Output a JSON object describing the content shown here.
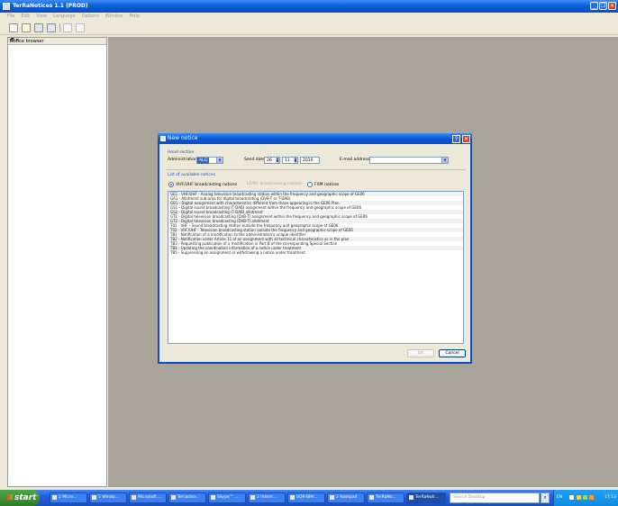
{
  "app": {
    "title": "TerRaNotices 1.1 (PROD)",
    "menu": [
      "File",
      "Edit",
      "View",
      "Language",
      "Options",
      "Window",
      "Help"
    ],
    "toolbar_icons": [
      "new-notice-icon",
      "open-notice-icon",
      "save-icon",
      "save-all-icon",
      "validate-icon",
      "submit-icon"
    ]
  },
  "notice_browser": {
    "title": "Notice browser",
    "controls": "🗗 ✕"
  },
  "dialog": {
    "title": "New notice",
    "head_section_label": "Head section",
    "administration_label": "Administration",
    "administration_value": "ALG",
    "send_date_label": "Send date",
    "send_date_day": "26",
    "send_date_month": "11",
    "send_date_year": "2010",
    "email_label": "E-mail address",
    "email_value": "",
    "list_label": "List of available notices",
    "radio_vhf": "VHF/UHF broadcasting notices",
    "radio_lfmf": "LF/MF broadcasting notices",
    "radio_fxm": "FXM notices",
    "notices": [
      "GE1 - VHF/UHF - Analog television broadcasting station within the frequency and geographic scope of GE06",
      "GA1 - Allotment sub-area for digital broadcasting (DVB-T or T-DAB)",
      "GB1 - Digital assignment with characteristics different from those appearing in the GE06 Plan",
      "GS1 - Digital sound broadcasting (T-DAB) assignment within the frequency and geographic scope of GE06",
      "GS2 - Digital sound broadcasting (T-DAB) allotment",
      "GT1 - Digital television broadcasting (DVB-T) assignment within the frequency and geographic scope of GE06",
      "GT2 - Digital television broadcasting (DVB-T) allotment",
      "T01 - VHF - Sound broadcasting station outside the frequency and geographic scope of GE06",
      "T02 - VHF/UHF - Television broadcasting station outside the frequency and geographic scope of GE06",
      "TB1 - Notification of a modification to the administration's unique identifier",
      "TB2 - Notification under Article 11 of an assignment with all technical characteristics as in the plan",
      "TB3 - Requesting publication of a modification in Part B of the corresponding Special Section",
      "TB4 - Updating the coordination information of a notice under treatment",
      "TB5 - Suppressing an assignment or withdrawing a notice under treatment"
    ],
    "ok_label": "OK",
    "cancel_label": "Cancel"
  },
  "taskbar": {
    "start_label": "start",
    "tasks": [
      "2 Micro...",
      "5 Windo...",
      "Microsoft ...",
      "Terrastea...",
      "Skype™ ...",
      "2 Intern...",
      "BOR-BIM...",
      "2 Notepad",
      "TerRaNo...",
      "TerRaNoti..."
    ],
    "search_placeholder": "Search Desktop",
    "language": "EN",
    "clock": "17:13"
  },
  "colors": {
    "title_blue": "#0b5fd8",
    "workspace": "#a9a59a",
    "section_label": "#1f4fbf",
    "taskbar": "#245edb",
    "start_green": "#3b8f33"
  }
}
